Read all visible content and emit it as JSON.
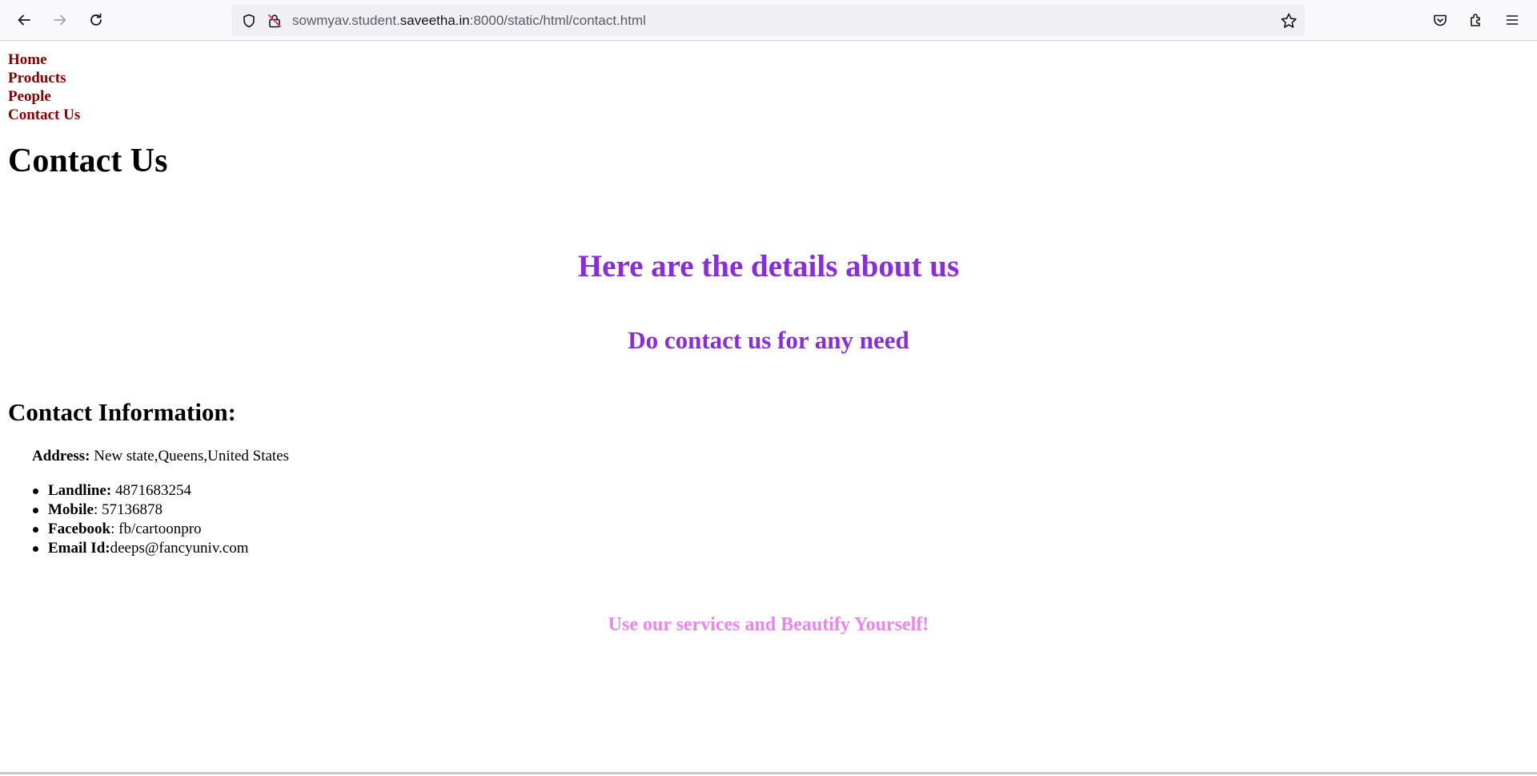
{
  "browser": {
    "url_prefix": "sowmyav.student.",
    "url_domain": "saveetha.in",
    "url_suffix": ":8000/static/html/contact.html",
    "icons": {
      "back": "back-arrow-icon",
      "forward": "forward-arrow-icon",
      "reload": "reload-icon",
      "shield": "shield-icon",
      "insecure": "insecure-lock-icon",
      "bookmark": "star-icon",
      "pocket": "pocket-icon",
      "extensions": "extensions-icon",
      "menu": "hamburger-menu-icon"
    }
  },
  "nav": {
    "items": [
      "Home",
      "Products",
      "People",
      "Contact Us"
    ]
  },
  "page": {
    "title": "Contact Us",
    "details_heading": "Here are the details about us",
    "contact_need": "Do contact us for any need",
    "info_heading": "Contact Information:",
    "address_label": "Address:",
    "address_value": " New state,Queens,United States",
    "contacts": [
      {
        "label": "Landline:",
        "value": " 4871683254"
      },
      {
        "label": "Mobile",
        "value": ": 57136878"
      },
      {
        "label": "Facebook",
        "value": ": fb/cartoonpro"
      },
      {
        "label": "Email Id:",
        "value": "deeps@fancyuniv.com"
      }
    ],
    "tagline": "Use our services and Beautify Yourself!"
  },
  "colors": {
    "nav_link": "#8b0000",
    "heading_purple": "#8a2be2",
    "tagline_violet": "#ee82ee"
  }
}
